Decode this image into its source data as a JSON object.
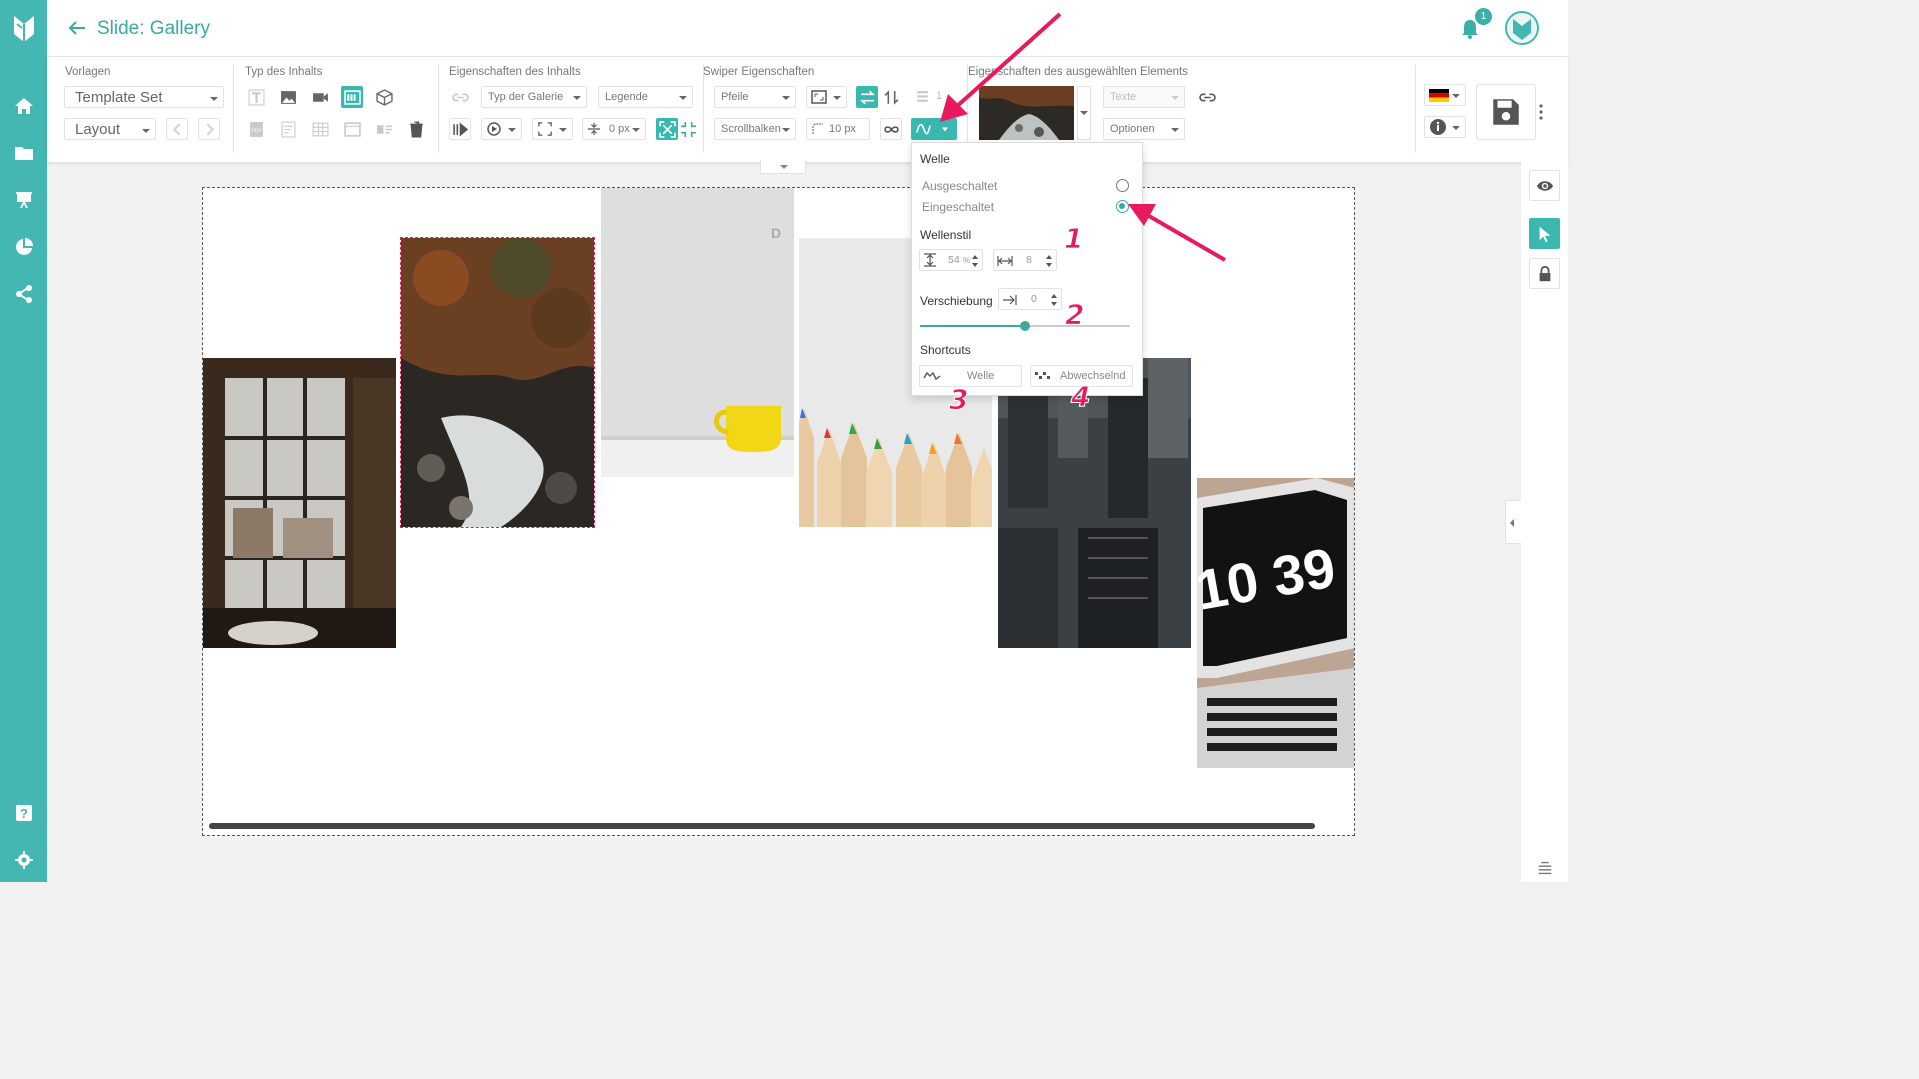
{
  "header": {
    "title": "Slide: Gallery",
    "notification_count": "1"
  },
  "toolbar": {
    "templates": {
      "label": "Vorlagen",
      "template_set": "Template Set",
      "layout": "Layout"
    },
    "content_type": {
      "label": "Typ des Inhalts"
    },
    "content_props": {
      "label": "Eigenschaften des Inhalts",
      "gallery_type": "Typ der Galerie",
      "legend": "Legende",
      "spacing": "0 px"
    },
    "swiper": {
      "label": "Swiper Eigenschaften",
      "arrows": "Pfeile",
      "scrollbar": "Scrollbalken",
      "radius_value": "10",
      "radius_unit": "px",
      "hidden_value": "1"
    },
    "selected": {
      "label": "Eigenschaften des ausgewählten Elements",
      "texts": "Texte",
      "options": "Optionen"
    }
  },
  "wave_popup": {
    "title": "Welle",
    "off_label": "Ausgeschaltet",
    "on_label": "Eingeschaltet",
    "selected": "on",
    "style_label": "Wellenstil",
    "amplitude": "54",
    "amplitude_unit": "%",
    "count": "8",
    "offset_label": "Verschiebung",
    "offset_value": "0",
    "slider_fraction": 0.5,
    "shortcuts_label": "Shortcuts",
    "shortcut_wave": "Welle",
    "shortcut_alternate": "Abwechselnd"
  },
  "annotations": [
    "1",
    "2",
    "3",
    "4"
  ],
  "colors": {
    "accent": "#45b7b2",
    "annotation": "#e8195c"
  },
  "icons": [
    "logo-icon",
    "home-icon",
    "folder-icon",
    "presentation-icon",
    "pie-chart-icon",
    "share-icon",
    "help-icon",
    "settings-icon",
    "bell-icon",
    "eye-icon",
    "cursor-icon",
    "lock-icon",
    "save-icon"
  ]
}
